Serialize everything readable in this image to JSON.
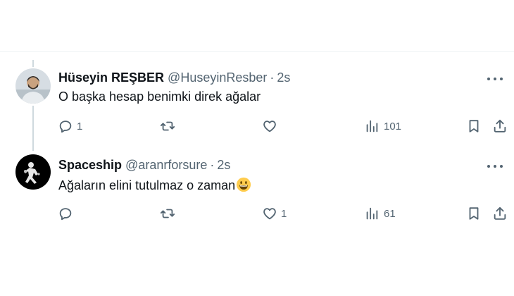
{
  "tweets": [
    {
      "display_name": "Hüseyin REŞBER",
      "handle": "@HuseyinResber",
      "separator": "·",
      "time": "2s",
      "text": "O başka hesap benimki direk ağalar",
      "reply_count": "1",
      "retweet_count": "",
      "like_count": "",
      "views": "101"
    },
    {
      "display_name": "Spaceship",
      "handle": "@aranrforsure",
      "separator": "·",
      "time": "2s",
      "text": "Ağaların elini tutulmaz o zaman",
      "emoji": "grinning-face-emoji",
      "reply_count": "",
      "retweet_count": "",
      "like_count": "1",
      "views": "61"
    }
  ],
  "icons": [
    "reply-icon",
    "retweet-icon",
    "like-icon",
    "views-icon",
    "bookmark-icon",
    "share-icon",
    "more-icon"
  ],
  "colors": {
    "text": "#0f1419",
    "muted": "#536471",
    "thread_line": "#cfd9de",
    "border": "#eff3f4"
  }
}
